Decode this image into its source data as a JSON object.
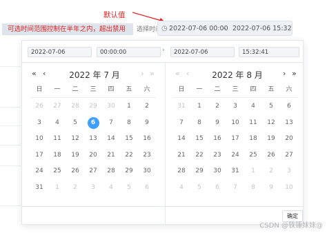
{
  "annotations": {
    "default_value_label": "默认值",
    "range_note": "可选时间范围控制在半年之内，超出禁用"
  },
  "range_input": {
    "label": "选择时间",
    "start": "2022-07-06 00:00",
    "separator": "-",
    "end": "2022-07-06 15:32"
  },
  "picker": {
    "start_date": "2022-07-06",
    "start_time": "00:00:00",
    "end_date": "2022-07-06",
    "end_time": "15:32:41",
    "weekdays": [
      "日",
      "一",
      "二",
      "三",
      "四",
      "五",
      "六"
    ],
    "left": {
      "title": "2022 年 7 月",
      "weeks": [
        [
          "26",
          "27",
          "28",
          "29",
          "30",
          "1",
          "2"
        ],
        [
          "3",
          "4",
          "5",
          "6",
          "7",
          "8",
          "9"
        ],
        [
          "10",
          "11",
          "12",
          "13",
          "14",
          "15",
          "16"
        ],
        [
          "17",
          "18",
          "19",
          "20",
          "21",
          "22",
          "23"
        ],
        [
          "24",
          "25",
          "26",
          "27",
          "28",
          "29",
          "30"
        ],
        [
          "31",
          "1",
          "2",
          "3",
          "4",
          "5",
          "6"
        ]
      ]
    },
    "right": {
      "title": "2022 年 8 月",
      "weeks": [
        [
          "31",
          "1",
          "2",
          "3",
          "4",
          "5",
          "6"
        ],
        [
          "7",
          "8",
          "9",
          "10",
          "11",
          "12",
          "13"
        ],
        [
          "14",
          "15",
          "16",
          "17",
          "18",
          "19",
          "20"
        ],
        [
          "21",
          "22",
          "23",
          "24",
          "25",
          "26",
          "27"
        ],
        [
          "28",
          "29",
          "30",
          "31",
          "1",
          "2",
          "3"
        ],
        [
          "4",
          "5",
          "6",
          "7",
          "8",
          "9",
          "10"
        ]
      ]
    },
    "confirm_label": "确定",
    "nav": {
      "prev_year": "«",
      "prev_month": "‹",
      "next_month": "›",
      "next_year": "»"
    }
  },
  "watermark": "CSDN @铁锤妹妹@",
  "colors": {
    "accent": "#409eff",
    "annotation": "#e02020"
  }
}
